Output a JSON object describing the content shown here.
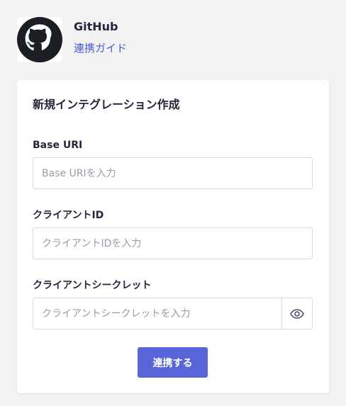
{
  "header": {
    "service_name": "GitHub",
    "guide_link": "連携ガイド",
    "logo_icon": "github-icon"
  },
  "form": {
    "title": "新規インテグレーション作成",
    "base_uri": {
      "label": "Base URI",
      "placeholder": "Base URIを入力",
      "value": ""
    },
    "client_id": {
      "label": "クライアントID",
      "placeholder": "クライアントIDを入力",
      "value": ""
    },
    "client_secret": {
      "label": "クライアントシークレット",
      "placeholder": "クライアントシークレットを入力",
      "value": "",
      "toggle_icon": "eye-icon"
    },
    "submit_label": "連携する"
  },
  "colors": {
    "accent": "#5865d8",
    "link": "#4a5bd4",
    "background": "#f2f2f2",
    "card": "#ffffff"
  }
}
